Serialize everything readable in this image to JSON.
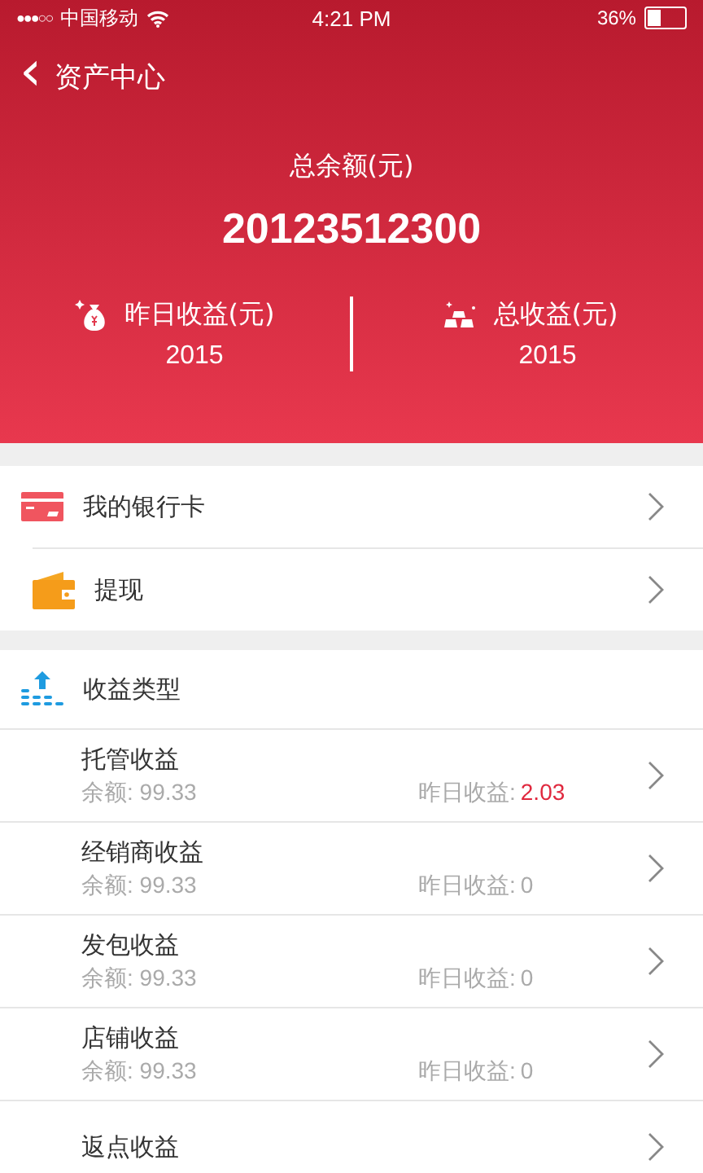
{
  "status_bar": {
    "signal_dots": "●●●○○",
    "carrier": "中国移动",
    "time": "4:21 PM",
    "battery": "36%"
  },
  "nav": {
    "back": "‹",
    "title": "资产中心"
  },
  "summary": {
    "label": "总余额(元)",
    "amount": "20123512300",
    "stats": [
      {
        "kind": "moneybag",
        "label": "昨日收益(元)",
        "value": "2015"
      },
      {
        "kind": "goldbars",
        "label": "总收益(元)",
        "value": "2015"
      }
    ]
  },
  "menu": [
    {
      "kind": "card",
      "label": "我的银行卡"
    },
    {
      "kind": "wallet",
      "label": "提现"
    }
  ],
  "income": {
    "title": "收益类型",
    "rows": [
      {
        "name": "托管收益",
        "balance_label": "余额:",
        "balance": "99.33",
        "yesterday_label": "昨日收益:",
        "yesterday": "2.03",
        "highlight": true
      },
      {
        "name": "经销商收益",
        "balance_label": "余额:",
        "balance": "99.33",
        "yesterday_label": "昨日收益:",
        "yesterday": "0",
        "highlight": false
      },
      {
        "name": "发包收益",
        "balance_label": "余额:",
        "balance": "99.33",
        "yesterday_label": "昨日收益:",
        "yesterday": "0",
        "highlight": false
      },
      {
        "name": "店铺收益",
        "balance_label": "余额:",
        "balance": "99.33",
        "yesterday_label": "昨日收益:",
        "yesterday": "0",
        "highlight": false
      },
      {
        "name": "返点收益"
      }
    ]
  }
}
